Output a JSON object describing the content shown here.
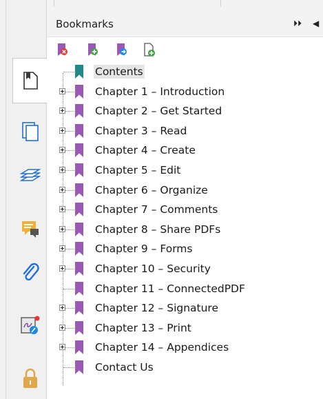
{
  "panel": {
    "title": "Bookmarks",
    "expand_button": "⏵⏵",
    "collapse_button": "◀"
  },
  "colors": {
    "bookmark": "#9b59b6",
    "bookmark_root": "#1f8a8a",
    "accent_red": "#e53935",
    "accent_green": "#43a047",
    "accent_blue": "#1e88e5",
    "lock": "#e0a84a"
  },
  "toolbar": [
    {
      "icon": "delete-bookmark-icon"
    },
    {
      "icon": "add-bookmark-icon"
    },
    {
      "icon": "add-child-bookmark-icon"
    },
    {
      "icon": "new-bookmark-from-page-icon"
    }
  ],
  "rail": [
    {
      "icon": "bookmarks-tab-icon",
      "active": true
    },
    {
      "icon": "pages-tab-icon"
    },
    {
      "icon": "layers-tab-icon"
    },
    {
      "icon": "comments-tab-icon"
    },
    {
      "icon": "attachments-tab-icon"
    },
    {
      "icon": "signatures-tab-icon"
    },
    {
      "icon": "security-tab-icon"
    }
  ],
  "bookmarks": [
    {
      "label": "Contents",
      "expandable": false,
      "root": true
    },
    {
      "label": "Chapter 1 – Introduction",
      "expandable": true
    },
    {
      "label": "Chapter 2 – Get Started",
      "expandable": true
    },
    {
      "label": "Chapter 3 – Read",
      "expandable": true
    },
    {
      "label": "Chapter 4 – Create",
      "expandable": true
    },
    {
      "label": "Chapter 5 – Edit",
      "expandable": true
    },
    {
      "label": "Chapter 6 – Organize",
      "expandable": true
    },
    {
      "label": "Chapter 7 – Comments",
      "expandable": true
    },
    {
      "label": "Chapter 8 – Share PDFs",
      "expandable": true
    },
    {
      "label": "Chapter 9 – Forms",
      "expandable": true
    },
    {
      "label": "Chapter 10 – Security",
      "expandable": true
    },
    {
      "label": "Chapter 11 – ConnectedPDF",
      "expandable": false
    },
    {
      "label": "Chapter 12 – Signature",
      "expandable": true
    },
    {
      "label": "Chapter 13 – Print",
      "expandable": true
    },
    {
      "label": "Chapter 14 – Appendices",
      "expandable": true
    },
    {
      "label": "Contact Us",
      "expandable": false
    }
  ]
}
